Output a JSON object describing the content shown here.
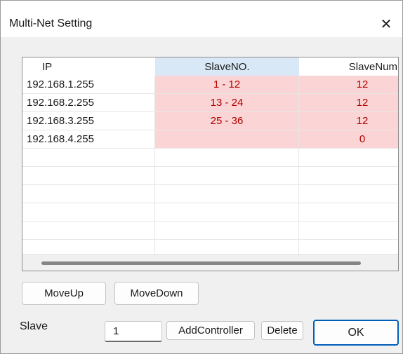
{
  "window": {
    "title": "Multi-Net Setting",
    "close_glyph": "✕"
  },
  "grid": {
    "columns": [
      "IP",
      "SlaveNO.",
      "SlaveNum"
    ],
    "rows": [
      {
        "ip": "192.168.1.255",
        "slave_no": "1 - 12",
        "slave_num": "12"
      },
      {
        "ip": "192.168.2.255",
        "slave_no": "13 - 24",
        "slave_num": "12"
      },
      {
        "ip": "192.168.3.255",
        "slave_no": "25 - 36",
        "slave_num": "12"
      },
      {
        "ip": "192.168.4.255",
        "slave_no": "",
        "slave_num": "0"
      }
    ],
    "empty_rows": 6,
    "highlight_color": "#fbd5d5",
    "value_color": "#b00000",
    "selected_header_color": "#d9e8f6"
  },
  "buttons": {
    "move_up": "MoveUp",
    "move_down": "MoveDown",
    "add_controller": "AddController",
    "delete": "Delete",
    "ok": "OK"
  },
  "slave": {
    "label": "Slave",
    "value": "1"
  }
}
